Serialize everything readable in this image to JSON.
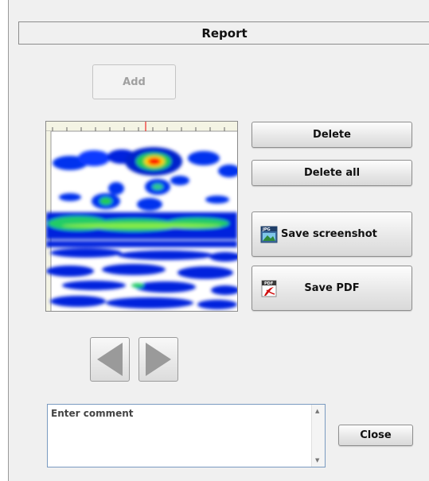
{
  "window": {
    "title": "Report"
  },
  "buttons": {
    "add": "Add",
    "delete": "Delete",
    "delete_all": "Delete all",
    "save_screenshot": "Save screenshot",
    "save_pdf": "Save PDF",
    "close": "Close"
  },
  "comment": {
    "placeholder": "Enter comment"
  },
  "icons": {
    "save_screenshot": "jpg-image-icon",
    "save_pdf": "pdf-icon",
    "prev": "arrow-left-icon",
    "next": "arrow-right-icon"
  },
  "colors": {
    "panel": "#f0f0f0",
    "arrow_fill": "#9a9a9a",
    "heat_red": "#ff0000",
    "heat_blue": "#0022dd",
    "heat_green": "#22cc55"
  }
}
